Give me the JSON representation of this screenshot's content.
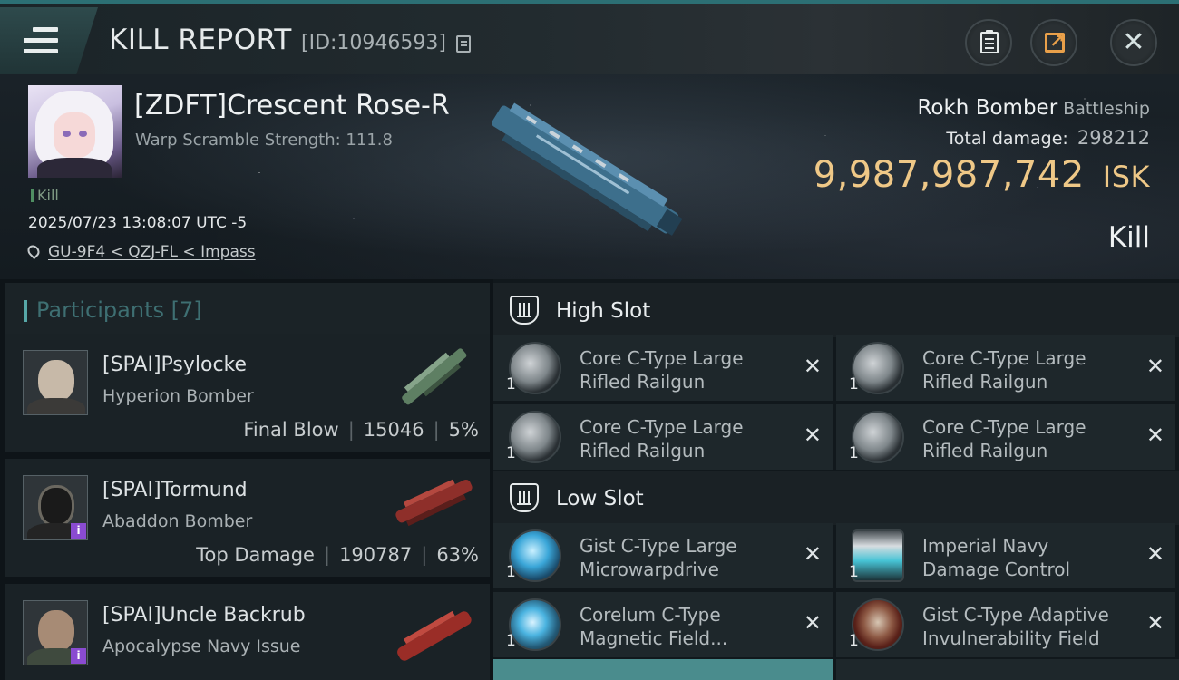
{
  "header": {
    "title": "KILL REPORT",
    "report_id": "[ID:10946593]",
    "menu_icon": "hamburger-icon",
    "actions": [
      "clipboard-icon",
      "share-icon",
      "close-icon"
    ],
    "close_glyph": "✕"
  },
  "victim": {
    "name": "[ZDFT]Crescent Rose-R",
    "warp_scramble": "Warp Scramble Strength: 111.8",
    "tag": "Kill",
    "time": "2025/07/23 13:08:07 UTC -5",
    "location": "GU-9F4 < QZJ-FL < Impass",
    "ship": "Rokh Bomber",
    "ship_class": "Battleship",
    "total_damage_label": "Total damage:",
    "total_damage": "298212",
    "isk": "9,987,987,742",
    "isk_unit": "ISK",
    "result": "Kill"
  },
  "participants": {
    "label": "Participants",
    "count": "[7]",
    "items": [
      {
        "name": "[SPAI]Psylocke",
        "ship": "Hyperion Bomber",
        "role": "Final Blow",
        "damage": "15046",
        "percent": "5%"
      },
      {
        "name": "[SPAI]Tormund",
        "ship": "Abaddon Bomber",
        "role": "Top Damage",
        "damage": "190787",
        "percent": "63%",
        "badge": "i"
      },
      {
        "name": "[SPAI]Uncle Backrub",
        "ship": "Apocalypse Navy Issue",
        "badge": "i"
      }
    ]
  },
  "fittings": {
    "high_slot": {
      "title": "High Slot",
      "modules": [
        {
          "name_line1": "Core C-Type Large",
          "name_line2": "Rifled Railgun",
          "qty": "1",
          "remove": "✕"
        },
        {
          "name_line1": "Core C-Type Large",
          "name_line2": "Rifled Railgun",
          "qty": "1",
          "remove": "✕"
        },
        {
          "name_line1": "Core C-Type Large",
          "name_line2": "Rifled Railgun",
          "qty": "1",
          "remove": "✕"
        },
        {
          "name_line1": "Core C-Type Large",
          "name_line2": "Rifled Railgun",
          "qty": "1",
          "remove": "✕"
        }
      ]
    },
    "low_slot": {
      "title": "Low Slot",
      "modules": [
        {
          "name_line1": "Gist C-Type Large",
          "name_line2": "Microwarpdrive",
          "qty": "1",
          "remove": "✕"
        },
        {
          "name_line1": "Imperial Navy",
          "name_line2": "Damage Control",
          "qty": "1",
          "remove": "✕"
        },
        {
          "name_line1": "Corelum C-Type",
          "name_line2": "Magnetic Field...",
          "qty": "1",
          "remove": "✕"
        },
        {
          "name_line1": "Gist C-Type Adaptive",
          "name_line2": "Invulnerability Field",
          "qty": "1",
          "remove": "✕"
        }
      ]
    }
  },
  "colors": {
    "accent_teal": "#4a8c8d",
    "isk_gold": "#efc887",
    "share_orange": "#e9a04a",
    "badge_purple": "#8a4bd1"
  }
}
